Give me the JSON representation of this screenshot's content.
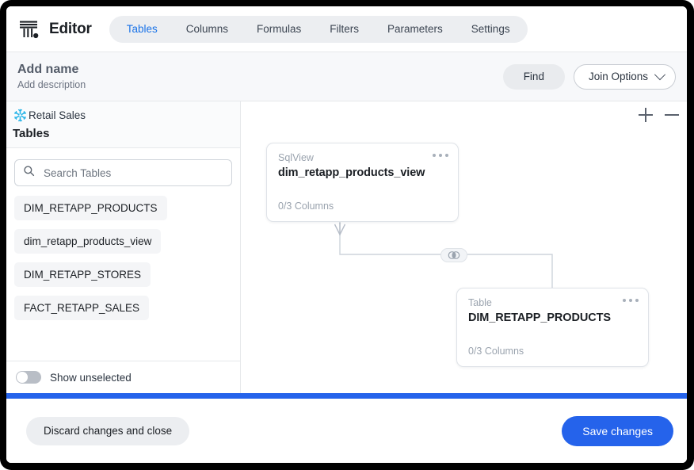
{
  "window": {
    "frame_color": "#000000",
    "accent_color": "#2563eb",
    "active_tab_color": "#1a73e8"
  },
  "topbar": {
    "logo_icon": "column-logo-icon",
    "brand_title": "Editor",
    "tabs": [
      {
        "label": "Tables",
        "active": true
      },
      {
        "label": "Columns",
        "active": false
      },
      {
        "label": "Formulas",
        "active": false
      },
      {
        "label": "Filters",
        "active": false
      },
      {
        "label": "Parameters",
        "active": false
      },
      {
        "label": "Settings",
        "active": false
      }
    ]
  },
  "subheader": {
    "name_placeholder": "Add name",
    "description_placeholder": "Add description",
    "find_label": "Find",
    "join_options_label": "Join Options",
    "join_options_icon": "chevron-down-icon"
  },
  "sidebar": {
    "source_icon": "snowflake-icon",
    "source_name": "Retail Sales",
    "heading": "Tables",
    "search": {
      "icon": "search-icon",
      "value": "",
      "placeholder": "Search Tables"
    },
    "tables": [
      {
        "label": "DIM_RETAPP_PRODUCTS"
      },
      {
        "label": "dim_retapp_products_view"
      },
      {
        "label": "DIM_RETAPP_STORES"
      },
      {
        "label": "FACT_RETAPP_SALES"
      }
    ],
    "show_unselected_label": "Show unselected",
    "show_unselected_on": false
  },
  "canvas": {
    "zoom_in_icon": "plus-icon",
    "zoom_out_icon": "minus-icon",
    "nodes": [
      {
        "kind": "SqlView",
        "title": "dim_retapp_products_view",
        "columns": "0/3 Columns",
        "menu_icon": "more-options-icon"
      },
      {
        "kind": "Table",
        "title": "DIM_RETAPP_PRODUCTS",
        "columns": "0/3 Columns",
        "menu_icon": "more-options-icon"
      }
    ],
    "join": {
      "icon": "inner-join-icon",
      "relationship_icon": "crows-foot-icon"
    }
  },
  "footer": {
    "progress_visible": true,
    "discard_label": "Discard changes and close",
    "save_label": "Save changes"
  }
}
